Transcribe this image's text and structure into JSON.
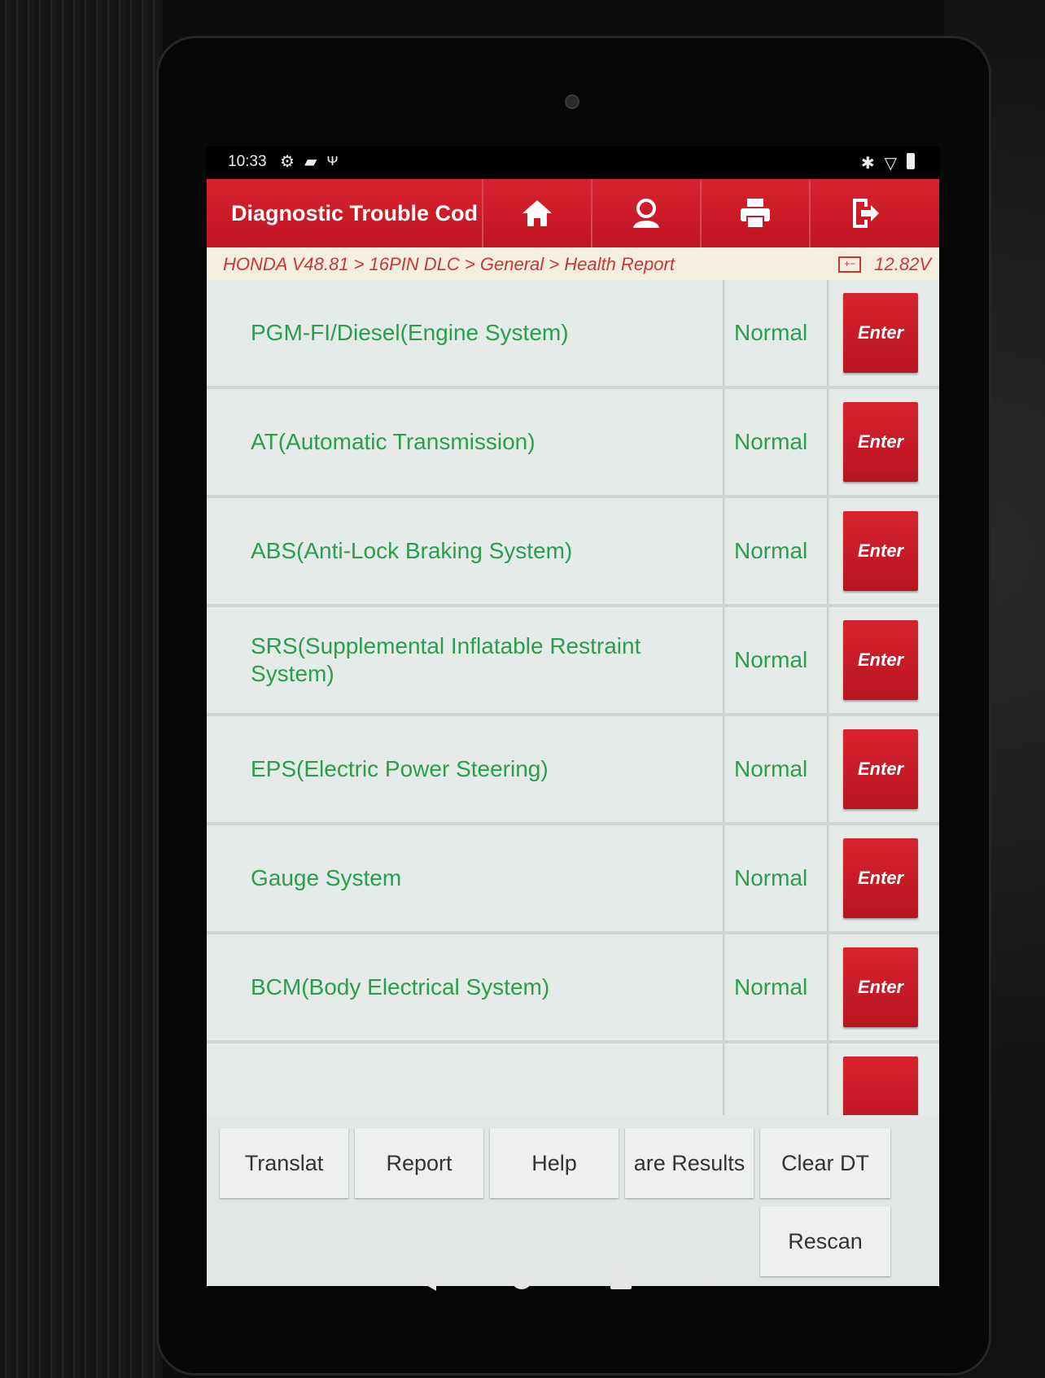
{
  "status_bar": {
    "time": "10:33",
    "left_icons": [
      "settings-icon",
      "message-icon",
      "usb-icon"
    ],
    "right_icons": [
      "bluetooth-icon",
      "wifi-icon",
      "battery-icon"
    ]
  },
  "header": {
    "title": "Diagnostic Trouble Cod",
    "buttons": [
      "home-icon",
      "support-icon",
      "print-icon",
      "exit-icon"
    ],
    "color": "#c81a27"
  },
  "breadcrumb": {
    "path": "HONDA V48.81 > 16PIN DLC > General > Health Report",
    "voltage": "12.82V"
  },
  "systems": [
    {
      "name": "PGM-FI/Diesel(Engine System)",
      "status": "Normal",
      "action": "Enter"
    },
    {
      "name": "AT(Automatic Transmission)",
      "status": "Normal",
      "action": "Enter"
    },
    {
      "name": "ABS(Anti-Lock Braking System)",
      "status": "Normal",
      "action": "Enter"
    },
    {
      "name": "SRS(Supplemental Inflatable Restraint System)",
      "status": "Normal",
      "action": "Enter"
    },
    {
      "name": "EPS(Electric Power Steering)",
      "status": "Normal",
      "action": "Enter"
    },
    {
      "name": "Gauge System",
      "status": "Normal",
      "action": "Enter"
    },
    {
      "name": "BCM(Body Electrical System)",
      "status": "Normal",
      "action": "Enter"
    }
  ],
  "footer": {
    "translate": "Translat",
    "report": "Report",
    "help": "Help",
    "compare_results": "are Results",
    "clear_dtc": "Clear DT",
    "rescan": "Rescan"
  },
  "colors": {
    "accent": "#c81a27",
    "status_text": "#2b9e4c",
    "list_bg": "#e4ebe8"
  }
}
